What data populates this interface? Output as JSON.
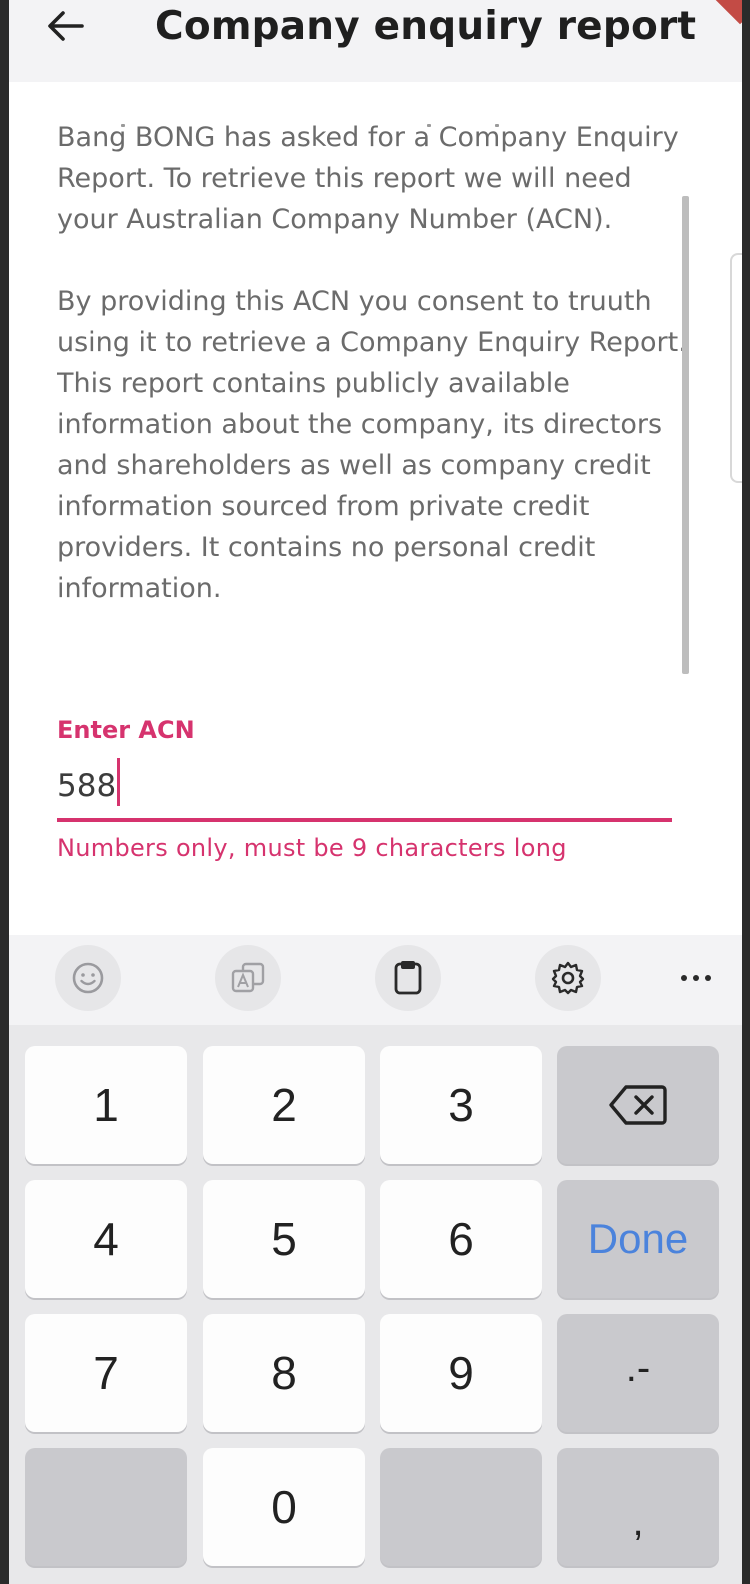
{
  "header": {
    "title": "Company enquiry report",
    "back_icon": "arrow-left-icon"
  },
  "body": {
    "paragraph1": "Bang BONG has asked for a Company Enquiry Report. To retrieve this report we will need your Australian Company Number (ACN).",
    "paragraph2": "By providing this ACN you consent to truuth using it to retrieve a Company Enquiry Report. This report contains publicly available information about the company, its directors and shareholders as well as company credit information sourced from private credit providers. It contains no personal credit information."
  },
  "acn_field": {
    "label": "Enter ACN",
    "value": "588",
    "error": "Numbers only, must be 9 characters long"
  },
  "keyboard_toolbar": {
    "items": [
      "emoji-icon",
      "translate-icon",
      "clipboard-icon",
      "settings-gear-icon",
      "more-dots-icon"
    ]
  },
  "keyboard": {
    "k1": "1",
    "k2": "2",
    "k3": "3",
    "k4": "4",
    "k5": "5",
    "k6": "6",
    "k7": "7",
    "k8": "8",
    "k9": "9",
    "k0": "0",
    "done": "Done",
    "dot_dash": ".-",
    "comma": ",",
    "backspace_icon": "backspace-icon"
  },
  "colors": {
    "accent": "#d6336e",
    "done_blue": "#4b83dc",
    "header_bg": "#f3f3f5",
    "body_text": "#6b6b6b"
  }
}
